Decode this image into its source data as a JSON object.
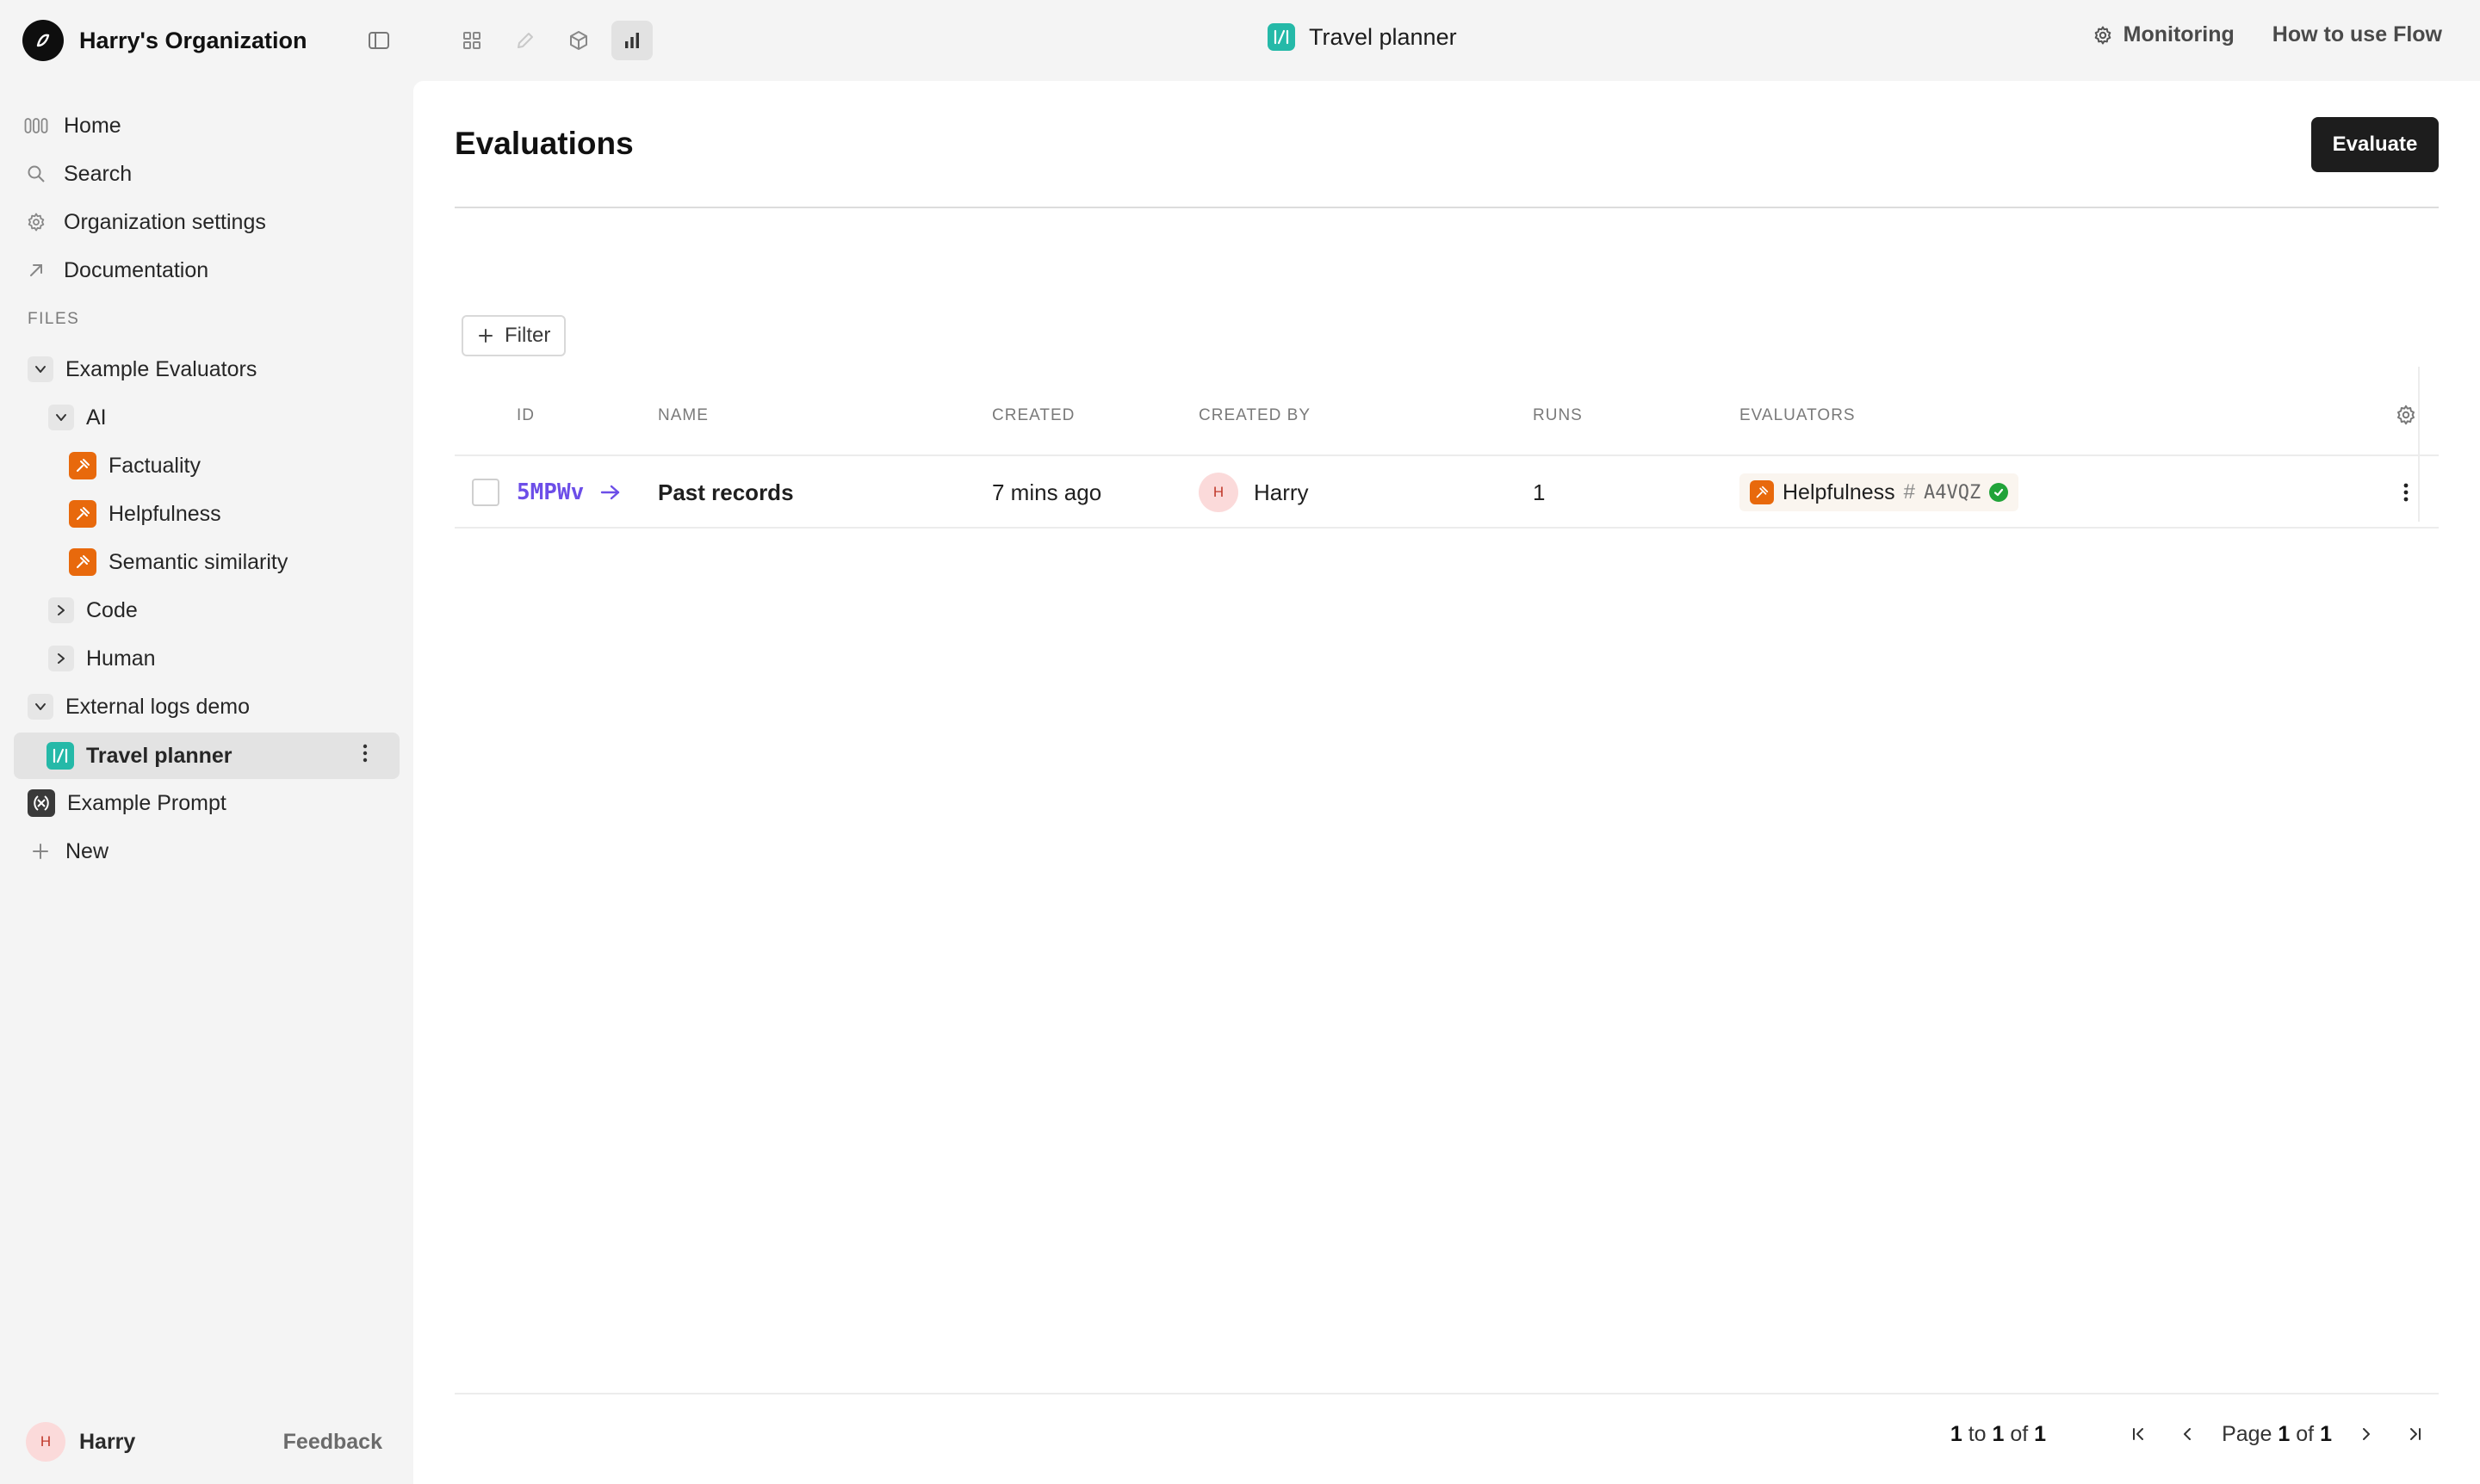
{
  "org": {
    "name": "Harry's Organization"
  },
  "header": {
    "file_title": "Travel planner",
    "monitoring": "Monitoring",
    "how_to": "How to use Flow"
  },
  "sidebar": {
    "nav": [
      {
        "label": "Home",
        "icon": "home-icon"
      },
      {
        "label": "Search",
        "icon": "search-icon"
      },
      {
        "label": "Organization settings",
        "icon": "gear-icon"
      },
      {
        "label": "Documentation",
        "icon": "external-arrow-icon"
      }
    ],
    "files_label": "FILES",
    "tree": {
      "example_evaluators": "Example Evaluators",
      "ai": "AI",
      "factuality": "Factuality",
      "helpfulness": "Helpfulness",
      "semantic_similarity": "Semantic similarity",
      "code": "Code",
      "human": "Human",
      "external_logs_demo": "External logs demo",
      "travel_planner": "Travel planner",
      "example_prompt": "Example Prompt",
      "new": "New"
    },
    "user": {
      "initial": "H",
      "name": "Harry"
    },
    "feedback": "Feedback"
  },
  "main": {
    "title": "Evaluations",
    "evaluate_label": "Evaluate",
    "filter_label": "Filter",
    "columns": {
      "id": "ID",
      "name": "NAME",
      "created": "CREATED",
      "created_by": "CREATED BY",
      "runs": "RUNS",
      "evaluators": "EVALUATORS"
    },
    "rows": [
      {
        "id": "5MPWv",
        "name": "Past records",
        "created": "7 mins ago",
        "created_by_initial": "H",
        "created_by": "Harry",
        "runs": "1",
        "evaluator": {
          "name": "Helpfulness",
          "hash": "#",
          "version": "A4VQZ",
          "status": "success"
        }
      }
    ],
    "pagination": {
      "from": "1",
      "to_word": "to",
      "to": "1",
      "of_word": "of",
      "total": "1",
      "page_word": "Page",
      "page": "1",
      "pages": "1"
    }
  },
  "colors": {
    "accent_id": "#6c4ee8",
    "evaluator_orange": "#e8690c",
    "flow_teal": "#25b9a8",
    "success_green": "#21a339",
    "primary_button": "#1d1d1d"
  }
}
